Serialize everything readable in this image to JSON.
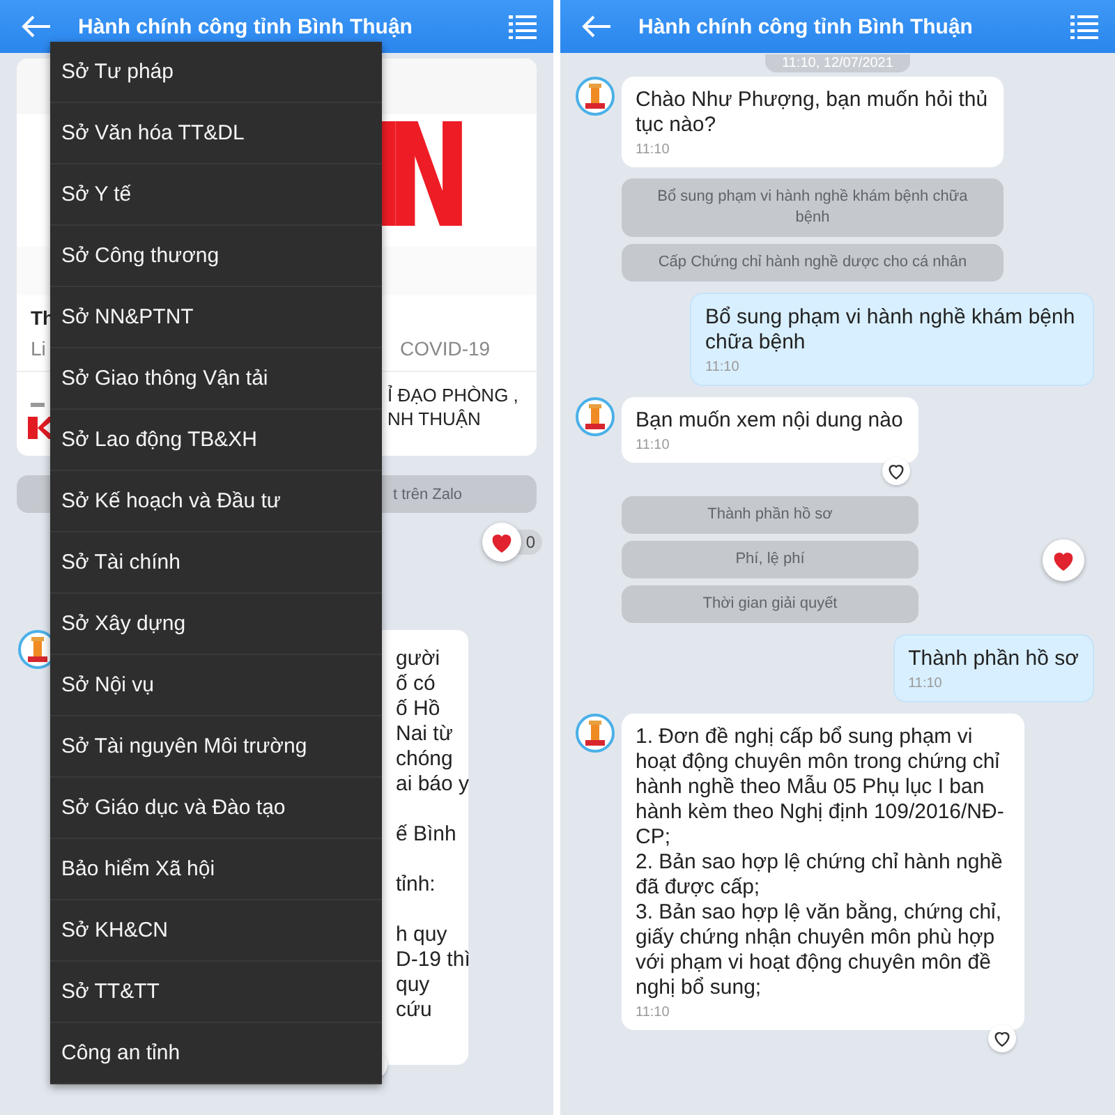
{
  "left_screen": {
    "header": {
      "title": "Hành chính công tỉnh Bình Thuận"
    },
    "news_card": {
      "title": "Th",
      "source": "Li",
      "tag": "COVID-19",
      "related_headline": [
        "Ỉ ĐẠO PHÒNG ,",
        "NH THUẬN"
      ]
    },
    "share_bar": "t trên Zalo",
    "reaction_count": "0",
    "message_paragraphs": [
      [
        "gười",
        "ố có",
        "ố Hồ",
        "Nai từ",
        "chóng",
        "ai báo y"
      ],
      [
        "ế Bình"
      ],
      [
        "tỉnh:"
      ],
      [
        "h quy",
        "D-19 thì",
        "quy",
        "cứu"
      ]
    ],
    "menu": {
      "items": [
        "Sở Tư pháp",
        "Sở Văn hóa TT&DL",
        "Sở Y tế",
        "Sở Công thương",
        "Sở NN&PTNT",
        "Sở Giao thông Vận tải",
        "Sở Lao động TB&XH",
        "Sở Kế hoạch và Đầu tư",
        "Sở Tài chính",
        "Sở Xây dựng",
        "Sở Nội vụ",
        "Sở Tài nguyên Môi trường",
        "Sở Giáo dục và Đào tạo",
        "Bảo hiểm Xã hội",
        "Sở KH&CN",
        "Sở TT&TT",
        "Công an tỉnh"
      ]
    }
  },
  "right_screen": {
    "header": {
      "title": "Hành chính công tỉnh Bình Thuận"
    },
    "date": "11:10, 12/07/2021",
    "messages": [
      {
        "kind": "bot",
        "text": "Chào Như Phượng, bạn muốn hỏi thủ tục nào?",
        "time": "11:10",
        "like_button": false
      },
      {
        "kind": "quick_replies",
        "options": [
          "Bổ sung phạm vi hành nghề khám bệnh chữa bệnh",
          "Cấp Chứng chỉ hành nghề dược cho cá nhân"
        ],
        "reacted": false
      },
      {
        "kind": "user",
        "text": "Bổ sung phạm vi hành nghề khám bệnh chữa bệnh",
        "time": "11:10"
      },
      {
        "kind": "bot",
        "text": "Bạn muốn xem nội dung nào",
        "time": "11:10",
        "like_button": true
      },
      {
        "kind": "quick_replies",
        "options": [
          "Thành phần hồ sơ",
          "Phí, lệ phí",
          "Thời gian giải quyết"
        ],
        "reacted": true
      },
      {
        "kind": "user",
        "text": "Thành phần hồ sơ",
        "time": "11:10"
      },
      {
        "kind": "bot",
        "text": "1. Đơn đề nghị cấp bổ sung phạm vi hoạt động chuyên môn trong chứng chỉ hành nghề theo Mẫu 05 Phụ lục I ban hành kèm theo Nghị định 109/2016/NĐ-CP;\n2. Bản sao hợp lệ chứng chỉ hành nghề đã được cấp;\n3. Bản sao hợp lệ văn bằng, chứng chỉ, giấy chứng nhận chuyên môn phù hợp với phạm vi hoạt động chuyên môn đề nghị bổ sung;",
        "time": "11:10",
        "like_button": true
      }
    ]
  }
}
